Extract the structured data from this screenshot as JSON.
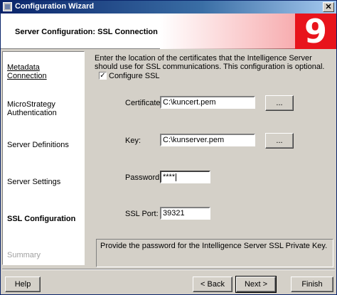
{
  "window": {
    "title": "Configuration Wizard",
    "close_glyph": "✕"
  },
  "header": {
    "heading": "Server Configuration: SSL Connection",
    "logo": "9"
  },
  "sidebar": {
    "items": [
      {
        "label": "Metadata Connection",
        "state": "link"
      },
      {
        "label": "MicroStrategy Authentication",
        "state": "normal"
      },
      {
        "label": "Server Definitions",
        "state": "normal"
      },
      {
        "label": "Server Settings",
        "state": "normal"
      },
      {
        "label": "SSL Configuration",
        "state": "active"
      },
      {
        "label": "Summary",
        "state": "disabled"
      }
    ]
  },
  "main": {
    "intro": "Enter the location of the certificates that the Intelligence Server should use for SSL communications. This configuration is optional.",
    "configure_ssl": {
      "label": "Configure SSL",
      "checked": true,
      "check_glyph": "✓"
    },
    "certificate": {
      "label": "Certificate:",
      "value": "C:\\kuncert.pem",
      "browse": "..."
    },
    "key": {
      "label": "Key:",
      "value": "C:\\kunserver.pem",
      "browse": "..."
    },
    "password": {
      "label": "Password:",
      "value": "****"
    },
    "ssl_port": {
      "label": "SSL Port:",
      "value": "39321"
    },
    "info": "Provide the password for the Intelligence Server SSL Private Key."
  },
  "footer": {
    "help": "Help",
    "back": "< Back",
    "next": "Next >",
    "finish": "Finish"
  }
}
